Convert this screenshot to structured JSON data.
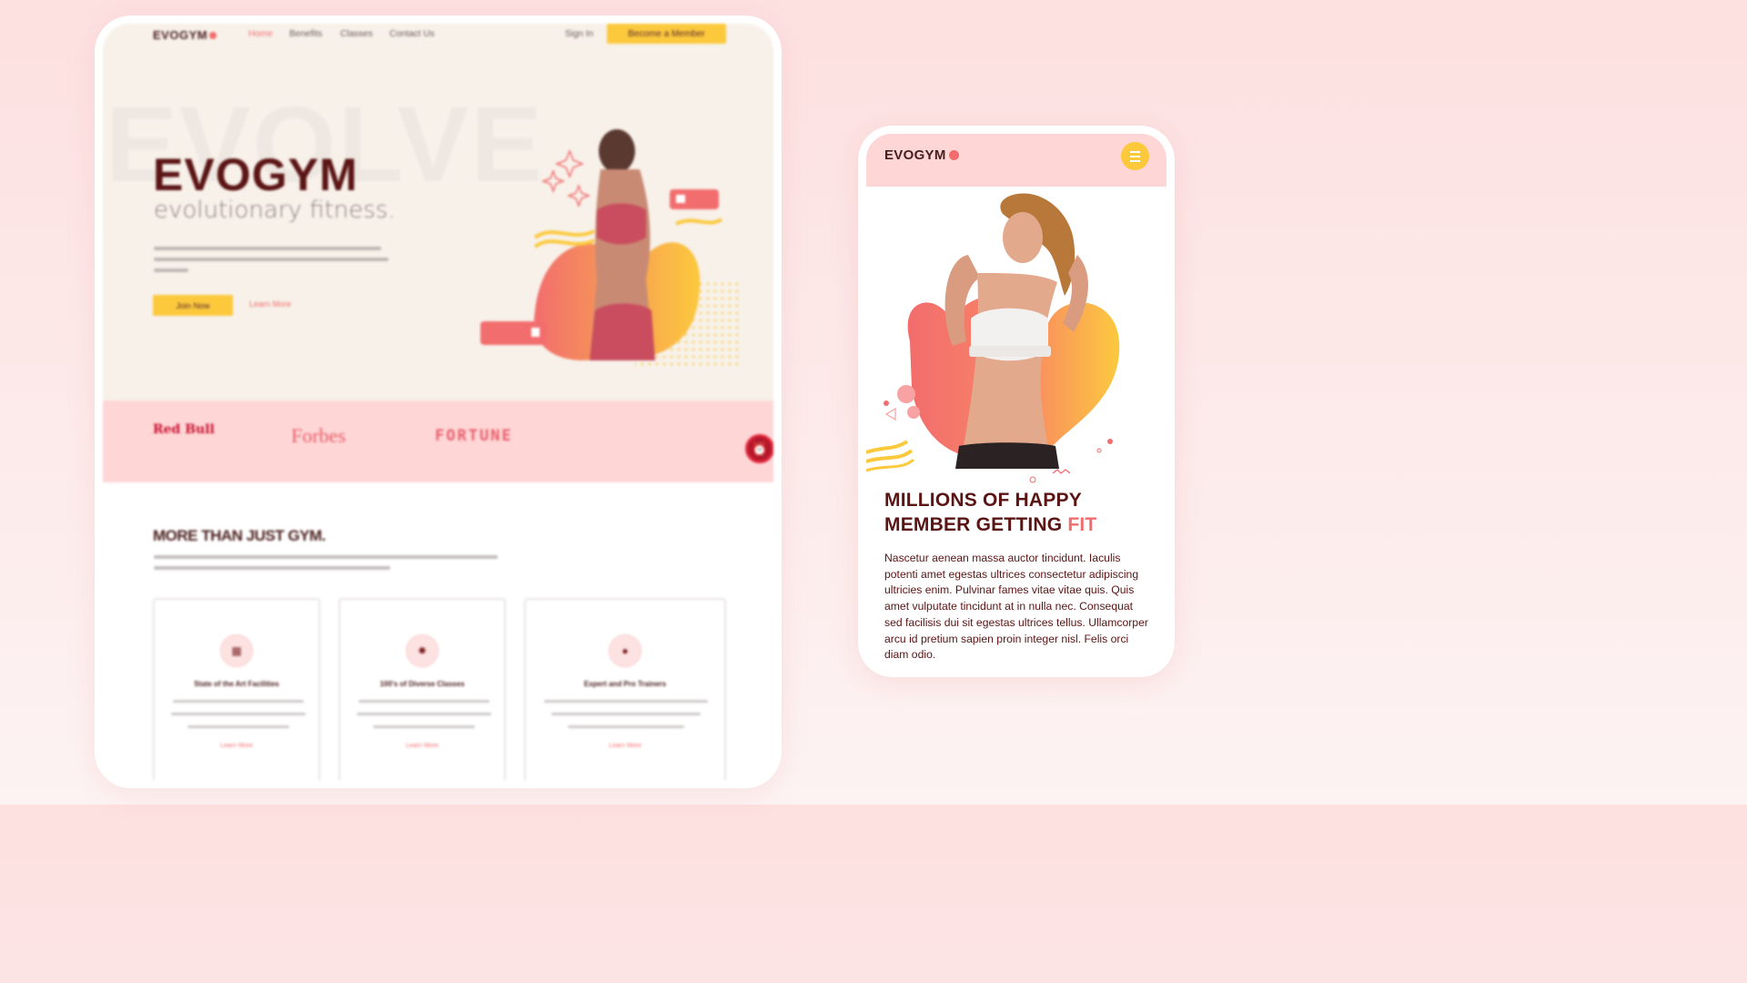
{
  "desktop": {
    "nav": {
      "logo": "EVOGYM",
      "links": [
        "Home",
        "Benefits",
        "Classes",
        "Contact Us"
      ],
      "sign_in": "Sign In",
      "cta": "Become a Member"
    },
    "hero": {
      "watermark": "EVOLVE",
      "brand": "EVOGYM",
      "tagline": "evolutionary fitness.",
      "join_button": "Join Now",
      "learn_more": "Learn More"
    },
    "sponsors": [
      "Red Bull",
      "Forbes",
      "FORTUNE"
    ],
    "benefits": {
      "title": "MORE THAN JUST GYM.",
      "cards": [
        {
          "title": "State of the Art Facilities",
          "learn_more": "Learn More"
        },
        {
          "title": "100's of Diverse Classes",
          "learn_more": "Learn More"
        },
        {
          "title": "Expert and Pro Trainers",
          "learn_more": "Learn More"
        }
      ]
    }
  },
  "mobile": {
    "nav": {
      "logo": "EVOGYM"
    },
    "title_line1": "MILLIONS OF HAPPY",
    "title_line2": "MEMBER GETTING ",
    "title_highlight": "FIT",
    "body": "Nascetur aenean massa auctor tincidunt. Iaculis potenti amet egestas ultrices consectetur adipiscing ultricies enim. Pulvinar fames vitae vitae quis. Quis amet vulputate tincidunt at in nulla nec. Consequat sed facilisis dui sit egestas ultrices tellus. Ullamcorper arcu id pretium sapien proin integer nisl. Felis orci diam odio."
  },
  "colors": {
    "accent_red": "#f26d6d",
    "accent_yellow": "#fcc93d",
    "dark_maroon": "#5b1414",
    "pink_band": "#fed6d6",
    "hero_bg": "#f7f1ea"
  },
  "icons": {
    "menu": "hamburger-icon",
    "sponsor_badge": "alarm-clock-icon",
    "card_icons": [
      "building-icon",
      "group-icon",
      "trainer-icon"
    ]
  }
}
